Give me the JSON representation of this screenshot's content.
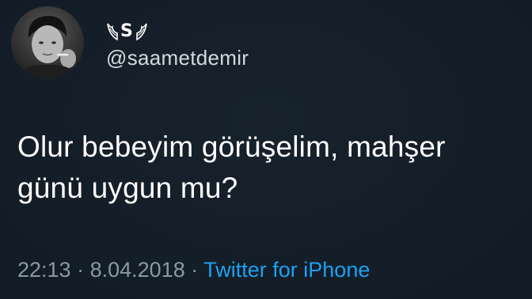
{
  "user": {
    "display_name": "S",
    "display_name_decoration": "angel-wings",
    "handle": "@saametdemir",
    "avatar": "profile-photo"
  },
  "tweet": {
    "text_lines": [
      "Olur bebeyim görüşelim, mahşer",
      "günü uygun mu?"
    ],
    "time": "22:13",
    "separator": "·",
    "date": "8.04.2018",
    "source": "Twitter for iPhone"
  },
  "colors": {
    "background": "#15202b",
    "text": "#ffffff",
    "secondary_text": "#8899a6",
    "link": "#1da1f2"
  }
}
